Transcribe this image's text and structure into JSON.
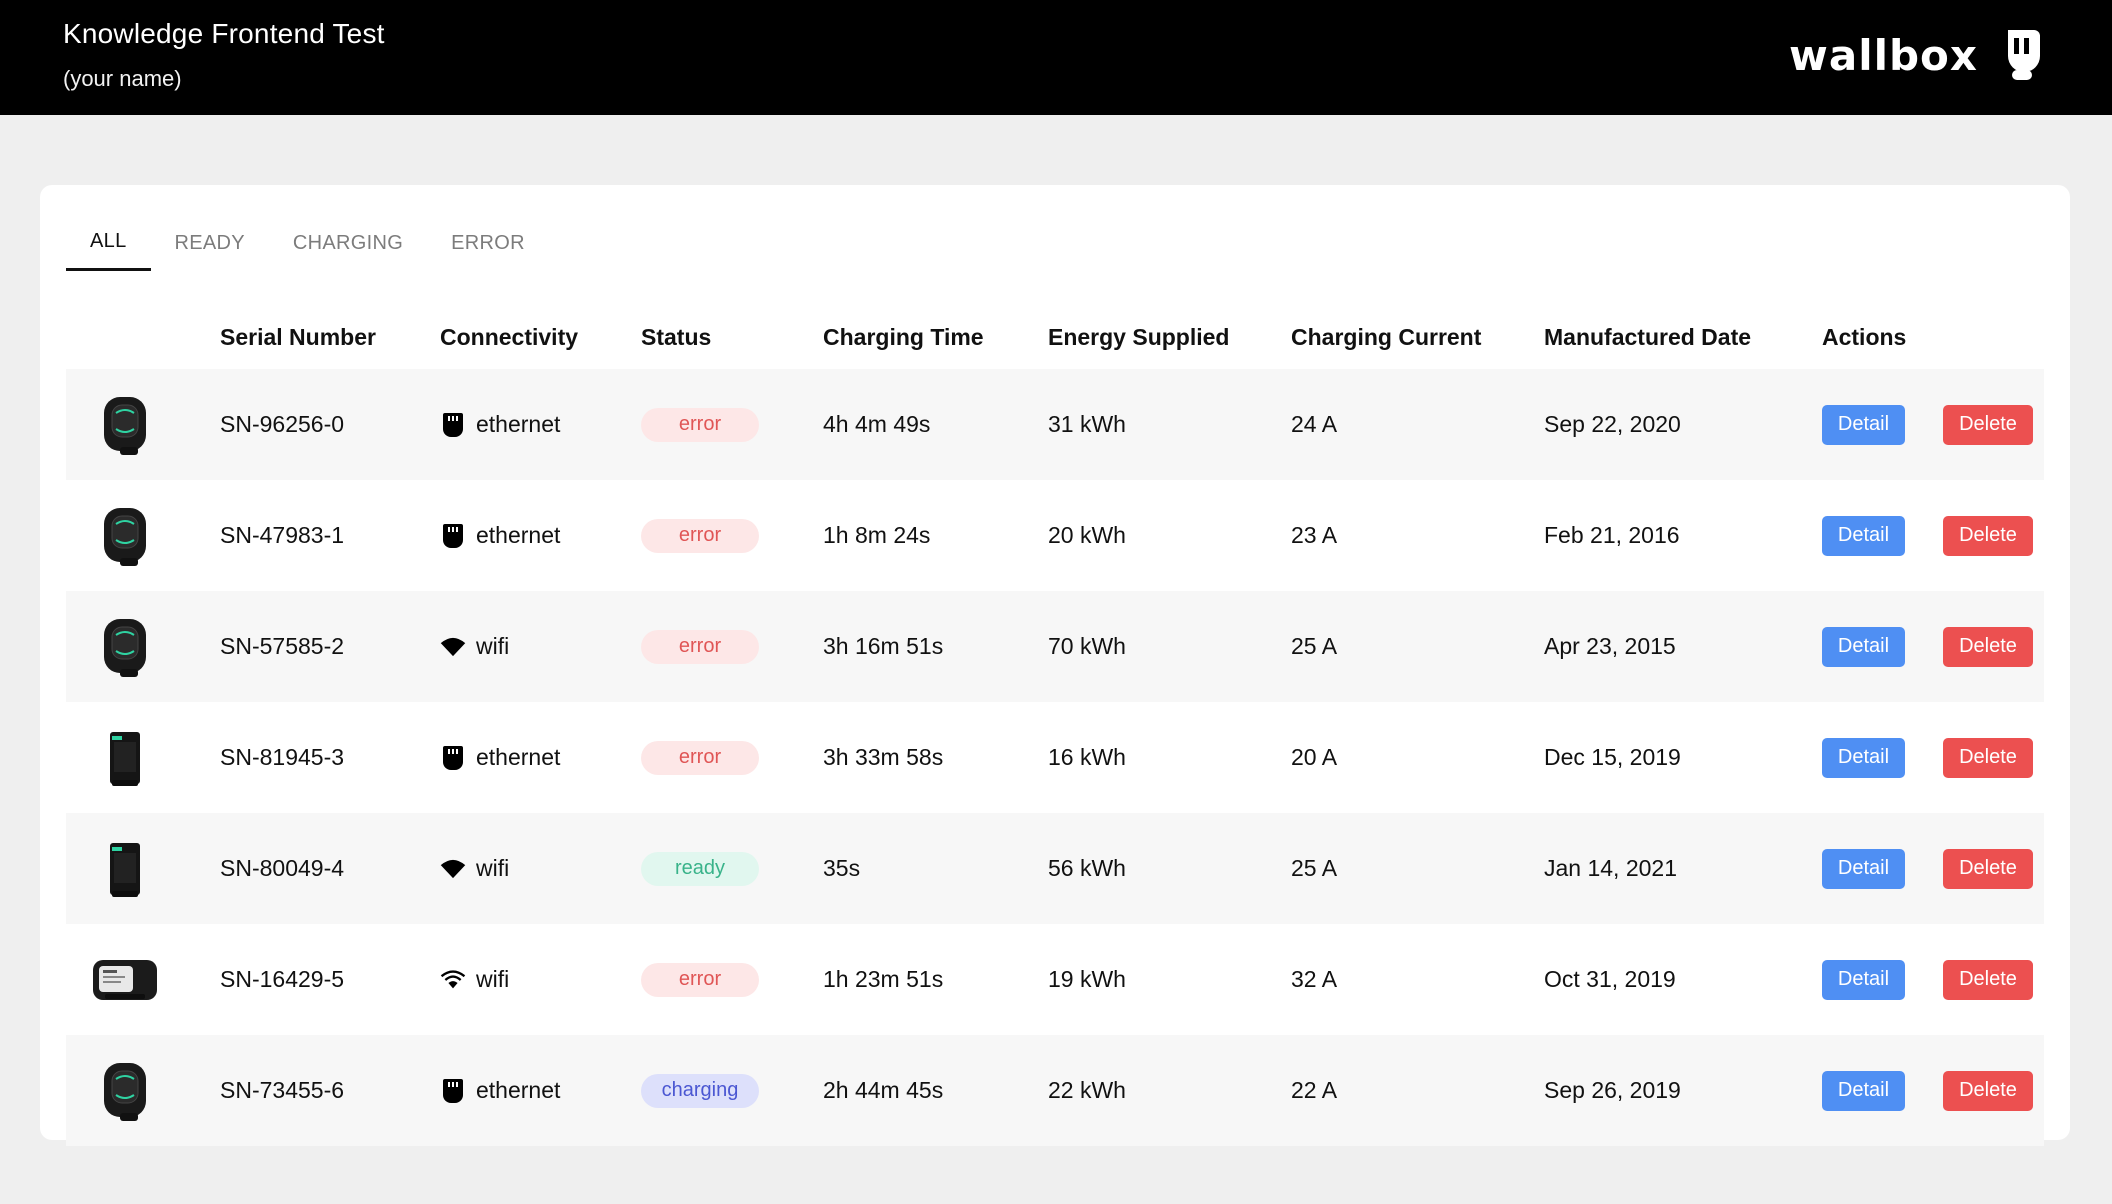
{
  "header": {
    "title": "Knowledge Frontend Test",
    "subtitle": "(your name)",
    "brand": "wallbox"
  },
  "tabs": [
    {
      "label": "ALL",
      "active": true
    },
    {
      "label": "READY",
      "active": false
    },
    {
      "label": "CHARGING",
      "active": false
    },
    {
      "label": "ERROR",
      "active": false
    }
  ],
  "columns": [
    "Serial Number",
    "Connectivity",
    "Status",
    "Charging Time",
    "Energy Supplied",
    "Charging Current",
    "Manufactured Date",
    "Actions"
  ],
  "actions": {
    "detail_label": "Detail",
    "delete_label": "Delete"
  },
  "rows": [
    {
      "device": "round-charger",
      "serial": "SN-96256-0",
      "connectivity": "ethernet",
      "status": "error",
      "time": "4h 4m 49s",
      "energy": "31 kWh",
      "current": "24 A",
      "date": "Sep 22, 2020"
    },
    {
      "device": "round-charger",
      "serial": "SN-47983-1",
      "connectivity": "ethernet",
      "status": "error",
      "time": "1h 8m 24s",
      "energy": "20 kWh",
      "current": "23 A",
      "date": "Feb 21, 2016"
    },
    {
      "device": "round-charger",
      "serial": "SN-57585-2",
      "connectivity": "wifi",
      "status": "error",
      "time": "3h 16m 51s",
      "energy": "70 kWh",
      "current": "25 A",
      "date": "Apr 23, 2015"
    },
    {
      "device": "box-charger",
      "serial": "SN-81945-3",
      "connectivity": "ethernet",
      "status": "error",
      "time": "3h 33m 58s",
      "energy": "16 kWh",
      "current": "20 A",
      "date": "Dec 15, 2019"
    },
    {
      "device": "box-charger",
      "serial": "SN-80049-4",
      "connectivity": "wifi",
      "status": "ready",
      "time": "35s",
      "energy": "56 kWh",
      "current": "25 A",
      "date": "Jan 14, 2021"
    },
    {
      "device": "wide-charger",
      "serial": "SN-16429-5",
      "connectivity": "wifi",
      "status": "error",
      "time": "1h 23m 51s",
      "energy": "19 kWh",
      "current": "32 A",
      "date": "Oct 31, 2019"
    },
    {
      "device": "round-charger",
      "serial": "SN-73455-6",
      "connectivity": "ethernet",
      "status": "charging",
      "time": "2h 44m 45s",
      "energy": "22 kWh",
      "current": "22 A",
      "date": "Sep 26, 2019"
    }
  ],
  "colors": {
    "header_bg": "#000000",
    "detail_button": "#4f8ff3",
    "delete_button": "#ec5050",
    "status_error": "#e05656",
    "status_ready": "#39b38a",
    "status_charging": "#4b57d2"
  }
}
